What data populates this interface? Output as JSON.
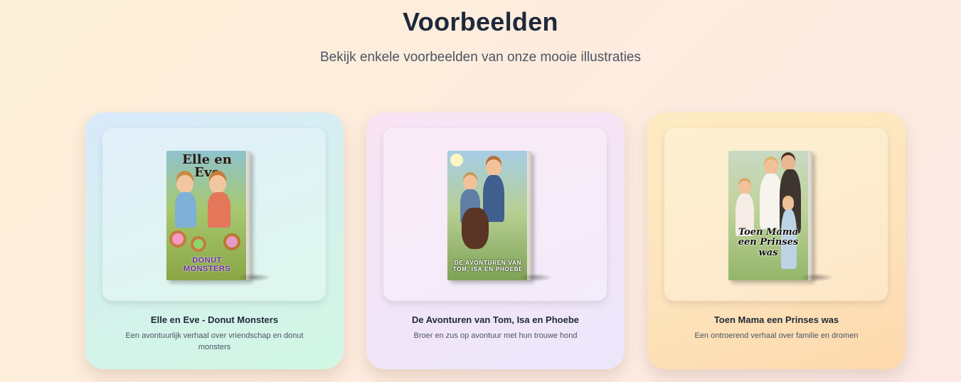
{
  "section": {
    "title": "Voorbeelden",
    "subtitle": "Bekijk enkele voorbeelden van onze mooie illustraties"
  },
  "cards": [
    {
      "title": "Elle en Eve - Donut Monsters",
      "description": "Een avontuurlijk verhaal over vriendschap en donut monsters",
      "cover_title": "Elle en Eve",
      "cover_subtitle": "DONUT MONSTERS",
      "theme": {
        "from": "#d9e9fb",
        "to": "#d2f7e4"
      }
    },
    {
      "title": "De Avonturen van Tom, Isa en Phoebe",
      "description": "Broer en zus op avontuur met hun trouwe hond",
      "cover_subtitle": "DE AVONTUREN VAN TOM, ISA EN PHOEBE",
      "theme": {
        "from": "#f8e3f3",
        "to": "#ece6fb"
      }
    },
    {
      "title": "Toen Mama een Prinses was",
      "description": "Een ontroerend verhaal over familie en dromen",
      "cover_title": "Toen Mama een Prinses was",
      "theme": {
        "from": "#fdebc2",
        "to": "#fdd8ad"
      }
    }
  ]
}
